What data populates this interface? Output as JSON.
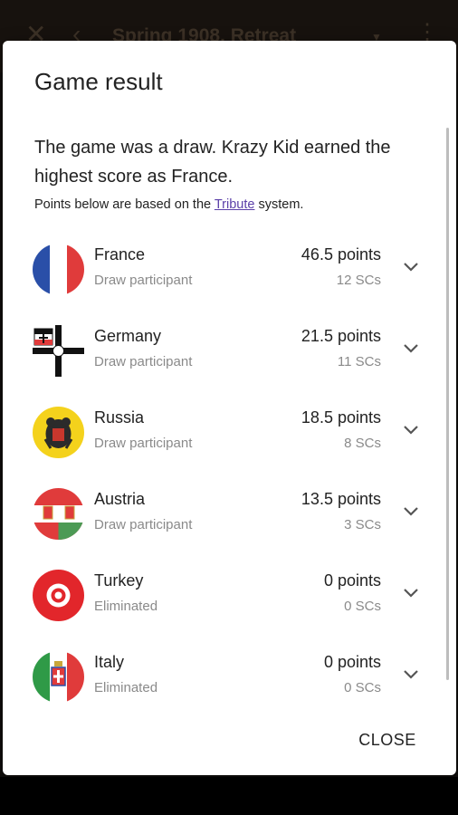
{
  "appbar": {
    "title": "Spring 1908, Retreat"
  },
  "dialog": {
    "title": "Game result",
    "summary": "The game was a draw. Krazy Kid earned the highest score as France.",
    "note_prefix": "Points below are based on the ",
    "note_link": "Tribute",
    "note_suffix": " system.",
    "close_label": "CLOSE"
  },
  "results": [
    {
      "country": "France",
      "status": "Draw participant",
      "points": "46.5 points",
      "scs": "12 SCs"
    },
    {
      "country": "Germany",
      "status": "Draw participant",
      "points": "21.5 points",
      "scs": "11 SCs"
    },
    {
      "country": "Russia",
      "status": "Draw participant",
      "points": "18.5 points",
      "scs": "8 SCs"
    },
    {
      "country": "Austria",
      "status": "Draw participant",
      "points": "13.5 points",
      "scs": "3 SCs"
    },
    {
      "country": "Turkey",
      "status": "Eliminated",
      "points": "0 points",
      "scs": "0 SCs"
    },
    {
      "country": "Italy",
      "status": "Eliminated",
      "points": "0 points",
      "scs": "0 SCs"
    }
  ],
  "colors": {
    "accent_link": "#5b3fa8",
    "secondary_text": "#8a8a8a",
    "appbar_text": "#6e5a45"
  }
}
